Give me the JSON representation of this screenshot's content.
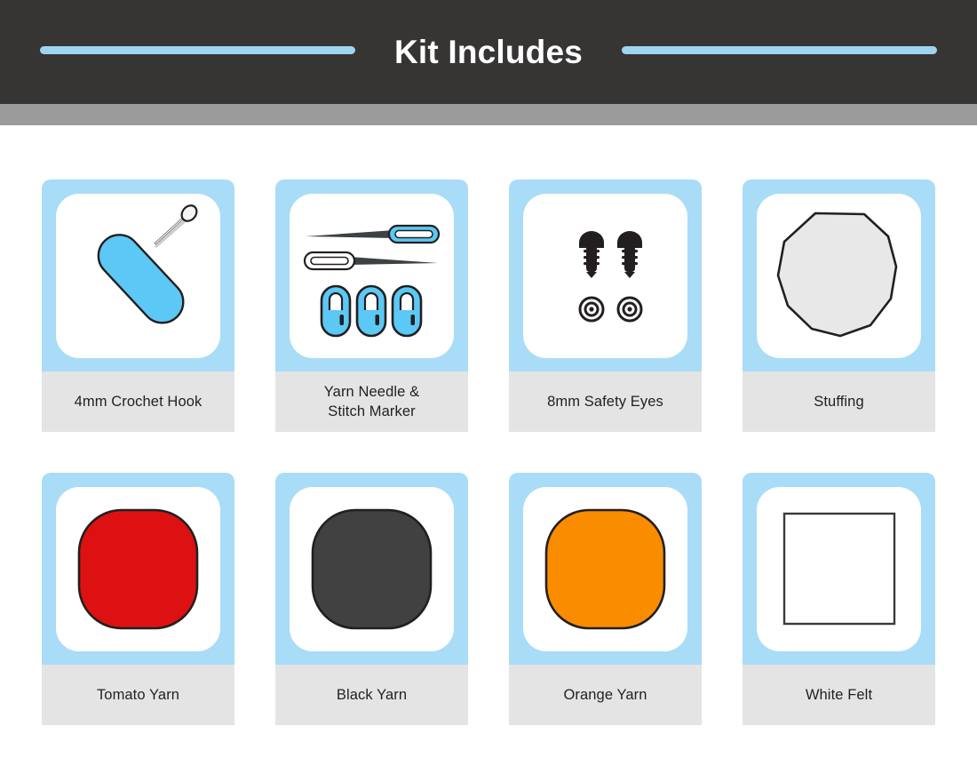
{
  "header": {
    "title": "Kit Includes",
    "background_color": "#373534",
    "title_color": "#ffffff",
    "rule_color": "#9ed4f2",
    "strip_color": "#9b9b9b"
  },
  "theme": {
    "card_frame_color": "#a9dcf7",
    "card_art_background": "#ffffff",
    "card_label_background": "#e4e4e4",
    "label_text_color": "#231f20",
    "page_background": "#ffffff"
  },
  "cards": [
    {
      "label": "4mm Crochet Hook",
      "icon": "crochet-hook-icon",
      "colors": {
        "handle": "#5bc8f5",
        "shaft": "#f2f4f5",
        "outline": "#231f20"
      }
    },
    {
      "label_line1": "Yarn Needle &",
      "label_line2": "Stitch Marker",
      "label": "Yarn Needle & Stitch Marker",
      "icon": "yarn-needle-stitch-marker-icon",
      "colors": {
        "needle_eye": "#5bc8f5",
        "needle_shaft": "#3c4144",
        "marker": "#5bc8f5",
        "outline": "#231f20"
      }
    },
    {
      "label": "8mm Safety Eyes",
      "icon": "safety-eyes-icon",
      "colors": {
        "eye": "#231f20",
        "washer": "#ffffff",
        "outline": "#231f20"
      }
    },
    {
      "label": "Stuffing",
      "icon": "stuffing-blob-icon",
      "colors": {
        "fill": "#e8e8e8",
        "outline": "#231f20"
      }
    },
    {
      "label": "Tomato Yarn",
      "icon": "yarn-swatch-icon",
      "colors": {
        "fill": "#dd1111",
        "outline": "#231f20"
      }
    },
    {
      "label": "Black Yarn",
      "icon": "yarn-swatch-icon",
      "colors": {
        "fill": "#414141",
        "outline": "#231f20"
      }
    },
    {
      "label": "Orange Yarn",
      "icon": "yarn-swatch-icon",
      "colors": {
        "fill": "#fa8c00",
        "outline": "#231f20"
      }
    },
    {
      "label": "White Felt",
      "icon": "felt-square-icon",
      "colors": {
        "fill": "#ffffff",
        "outline": "#3a3a3a"
      }
    }
  ]
}
